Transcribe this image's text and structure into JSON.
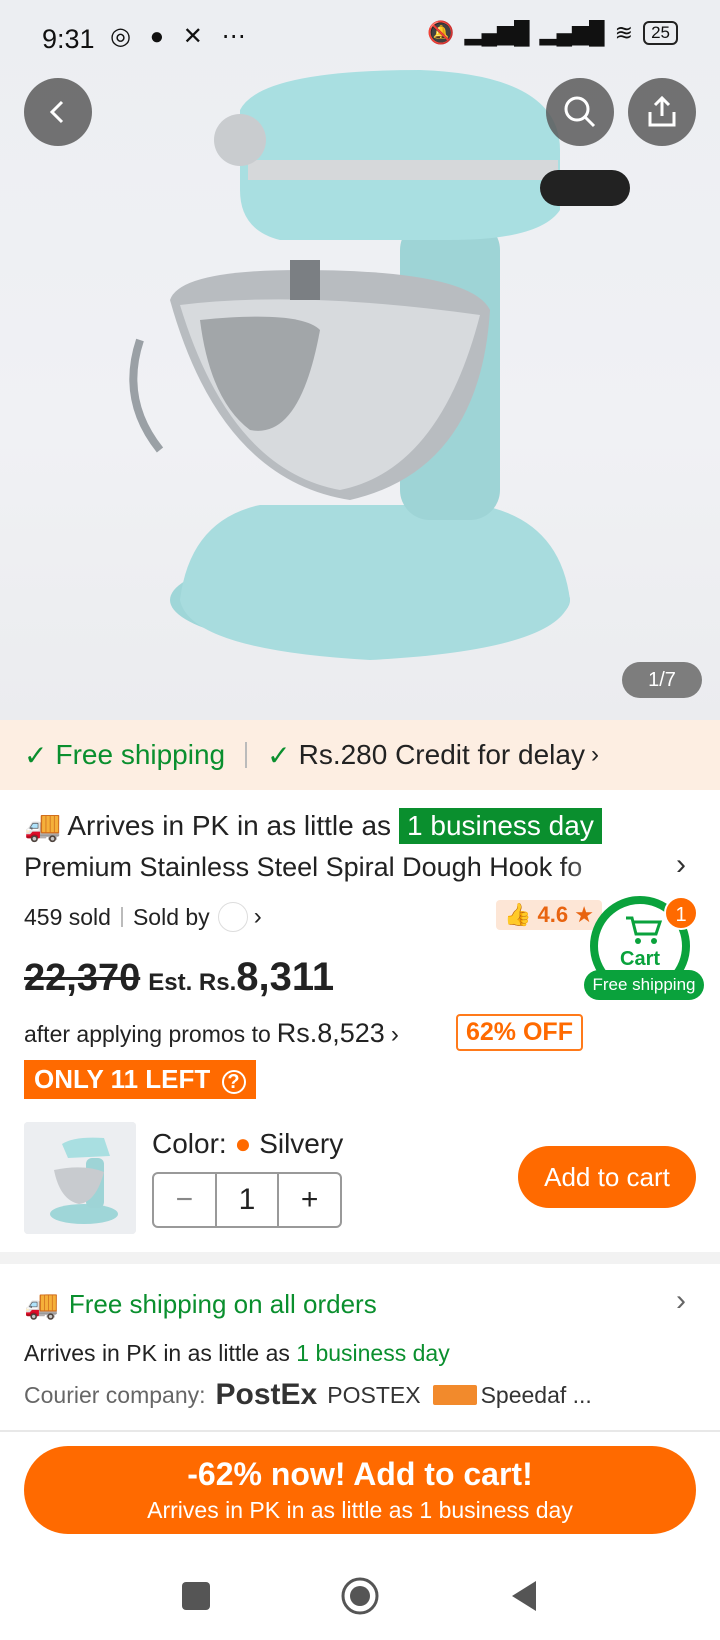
{
  "status_bar": {
    "time": "9:31",
    "left_icons": "whatsapp-icon, chat-icon, capcut-icon, more-dots",
    "battery": "25"
  },
  "hero": {
    "image_counter": "1/7"
  },
  "shipping_bar": {
    "free_shipping": "Free shipping",
    "credit": "Rs.280 Credit for delay"
  },
  "product": {
    "arrives_prefix": "Arrives in PK in as little as",
    "arrives_badge": "1 business day",
    "title": "Premium Stainless Steel Spiral Dough Hook fo",
    "sold": "459 sold",
    "sold_by": "Sold by",
    "rating": "4.6",
    "old_price": "22,370",
    "est_label": "Est. Rs.",
    "new_price": "8,311",
    "promo_text": "after applying promos to",
    "promo_price": "Rs.8,523",
    "discount": "62% OFF",
    "stock": "ONLY 11 LEFT"
  },
  "cart_widget": {
    "count": "1",
    "label": "Cart",
    "tag": "Free shipping"
  },
  "variant": {
    "color_label": "Color:",
    "color_value": "Silvery",
    "quantity": "1",
    "add_to_cart": "Add to cart"
  },
  "shipping_info": {
    "title": "Free shipping on all orders",
    "arrives_prefix": "Arrives in PK in as little as",
    "arrives_highlight": "1 business day",
    "courier_label": "Courier company:",
    "courier1": "PostEx",
    "courier2": "POSTEX",
    "courier3": "Speedaf ..."
  },
  "cta": {
    "line1": "-62% now! Add to cart!",
    "line2": "Arrives in PK in as little as 1 business day"
  },
  "colors": {
    "accent": "#ff6a00",
    "green": "#0a8f2e"
  }
}
